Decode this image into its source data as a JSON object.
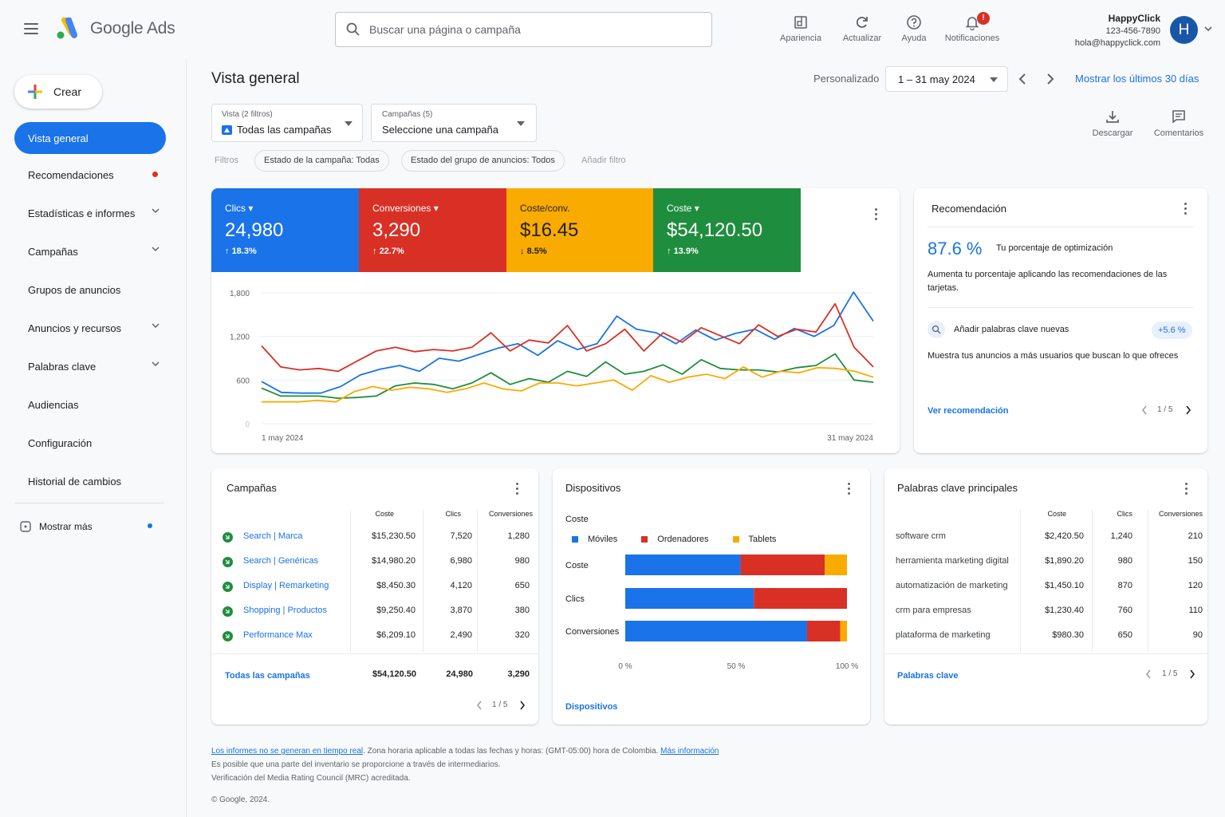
{
  "app": {
    "brand": "Google Ads"
  },
  "search": {
    "placeholder": "Buscar una página o campaña"
  },
  "toolbar": {
    "appearance": "Apariencia",
    "refresh": "Actualizar",
    "help": "Ayuda",
    "notifications": "Notificaciones",
    "notif_badge": "!"
  },
  "user": {
    "name": "HappyClick",
    "phone": "123-456-7890",
    "email": "hola@happyclick.com",
    "initial": "H"
  },
  "sidebar": {
    "create": "Crear",
    "items": [
      {
        "label": "Vista general"
      },
      {
        "label": "Recomendaciones"
      },
      {
        "label": "Estadísticas e informes"
      },
      {
        "label": "Campañas"
      },
      {
        "label": "Grupos de anuncios"
      },
      {
        "label": "Anuncios y recursos"
      },
      {
        "label": "Palabras clave"
      },
      {
        "label": "Audiencias"
      },
      {
        "label": "Configuración"
      },
      {
        "label": "Historial de cambios"
      }
    ],
    "more": "Mostrar más"
  },
  "page": {
    "title": "Vista general",
    "date_mode": "Personalizado",
    "date_range": "1 – 31 may 2024",
    "last30": "Mostrar los últimos 30 días",
    "view_label": "Vista (2 filtros)",
    "view_value": "Todas las campañas",
    "campaign_label": "Campañas (5)",
    "campaign_value": "Seleccione una campaña",
    "download": "Descargar",
    "comments": "Comentarios"
  },
  "filters": {
    "label": "Filtros",
    "chip1": "Estado de la campaña: Todas",
    "chip2": "Estado del grupo de anuncios: Todos",
    "add": "Añadir filtro"
  },
  "kpis": [
    {
      "label": "Clics",
      "value": "24,980",
      "change": "18.3%",
      "dir": "up",
      "color": "#1a73e8"
    },
    {
      "label": "Conversiones",
      "value": "3,290",
      "change": "22.7%",
      "dir": "up",
      "color": "#d93025"
    },
    {
      "label": "Coste/conv.",
      "value": "$16.45",
      "change": "8.5%",
      "dir": "down",
      "color": "#f9ab00"
    },
    {
      "label": "Coste",
      "value": "$54,120.50",
      "change": "13.9%",
      "dir": "up",
      "color": "#1e8e3e"
    }
  ],
  "chart_data": {
    "type": "line",
    "x_start": "1 may 2024",
    "x_end": "31 may 2024",
    "y_ticks": [
      "1,800",
      "1,200",
      "600",
      "0"
    ],
    "ylim": [
      0,
      1800
    ],
    "series": [
      {
        "color": "#1a73e8",
        "values": [
          580,
          430,
          420,
          420,
          510,
          670,
          750,
          800,
          720,
          900,
          860,
          950,
          1040,
          1100,
          940,
          1140,
          1020,
          1100,
          1480,
          1300,
          1250,
          1100,
          1290,
          1150,
          1240,
          1300,
          1160,
          1310,
          1200,
          1350,
          1810,
          1410
        ]
      },
      {
        "color": "#d93025",
        "values": [
          1070,
          780,
          740,
          760,
          720,
          860,
          1000,
          1050,
          990,
          1020,
          1000,
          1050,
          1250,
          1000,
          1150,
          1110,
          1350,
          1000,
          1100,
          1300,
          1000,
          1250,
          1120,
          1320,
          1210,
          1100,
          1360,
          1200,
          1300,
          1260,
          1650,
          1050,
          780
        ]
      },
      {
        "color": "#1e8e3e",
        "values": [
          490,
          380,
          380,
          380,
          350,
          360,
          380,
          520,
          560,
          540,
          480,
          560,
          700,
          540,
          620,
          570,
          720,
          650,
          850,
          680,
          720,
          810,
          680,
          880,
          760,
          740,
          740,
          710,
          770,
          800,
          960,
          600,
          570
        ]
      },
      {
        "color": "#f9ab00",
        "values": [
          300,
          300,
          300,
          320,
          300,
          440,
          510,
          460,
          500,
          480,
          430,
          480,
          560,
          480,
          450,
          560,
          560,
          520,
          560,
          600,
          460,
          660,
          570,
          640,
          680,
          620,
          780,
          640,
          720,
          700,
          770,
          760,
          720,
          640
        ]
      }
    ]
  },
  "recommendation": {
    "title": "Recomendación",
    "score": "87.6 %",
    "score_label": "Tu porcentaje de optimización",
    "desc": "Aumenta tu porcentaje aplicando las recomendaciones de las tarjetas.",
    "item_title": "Añadir palabras clave nuevas",
    "item_badge": "+5.6 %",
    "item_desc": "Muestra tus anuncios a más usuarios que buscan lo que ofreces",
    "link": "Ver recomendación",
    "pager": "1 / 5"
  },
  "campaigns": {
    "title": "Campañas",
    "headers": [
      "Coste",
      "Clics",
      "Conversiones"
    ],
    "rows": [
      {
        "name": "Search | Marca",
        "cost": "$15,230.50",
        "clicks": "7,520",
        "conv": "1,280"
      },
      {
        "name": "Search | Genéricas",
        "cost": "$14,980.20",
        "clicks": "6,980",
        "conv": "980"
      },
      {
        "name": "Display | Remarketing",
        "cost": "$8,450.30",
        "clicks": "4,120",
        "conv": "650"
      },
      {
        "name": "Shopping | Productos",
        "cost": "$9,250.40",
        "clicks": "3,870",
        "conv": "380"
      },
      {
        "name": "Performance Max",
        "cost": "$6,209.10",
        "clicks": "2,490",
        "conv": "320"
      }
    ],
    "total_label": "Todas las campañas",
    "total_cost": "$54,120.50",
    "total_clicks": "24,980",
    "total_conv": "3,290",
    "pager": "1 / 5"
  },
  "devices": {
    "title": "Dispositivos",
    "metric": "Coste",
    "legend": [
      {
        "name": "Móviles",
        "color": "#1a73e8"
      },
      {
        "name": "Ordenadores",
        "color": "#d93025"
      },
      {
        "name": "Tablets",
        "color": "#f9ab00"
      }
    ],
    "bars": [
      {
        "label": "Coste",
        "values": [
          52,
          38,
          10
        ]
      },
      {
        "label": "Clics",
        "values": [
          58,
          42,
          0
        ]
      },
      {
        "label": "Conversiones",
        "values": [
          82,
          15,
          3
        ]
      }
    ],
    "ticks": [
      "0 %",
      "50 %",
      "100 %"
    ],
    "link": "Dispositivos"
  },
  "keywords": {
    "title": "Palabras clave principales",
    "headers": [
      "Coste",
      "Clics",
      "Conversiones"
    ],
    "rows": [
      {
        "name": "software crm",
        "cost": "$2,420.50",
        "clicks": "1,240",
        "conv": "210"
      },
      {
        "name": "herramienta marketing digital",
        "cost": "$1,890.20",
        "clicks": "980",
        "conv": "150"
      },
      {
        "name": "automatización de marketing",
        "cost": "$1,450.10",
        "clicks": "870",
        "conv": "120"
      },
      {
        "name": "crm para empresas",
        "cost": "$1,230.40",
        "clicks": "760",
        "conv": "110"
      },
      {
        "name": "plataforma de marketing",
        "cost": "$980.30",
        "clicks": "650",
        "conv": "90"
      }
    ],
    "link": "Palabras clave",
    "pager": "1 / 5"
  },
  "footer": {
    "link1": "Los informes no se generan en tiempo real",
    "text1": ". Zona horaria aplicable a todas las fechas y horas: (GMT-05:00) hora de Colombia.",
    "link2": "Más información",
    "line2": "Es posible que una parte del inventario se proporcione a través de intermediarios.",
    "line3": "Verificación del Media Rating Council (MRC) acreditada.",
    "copyright": "© Google, 2024."
  }
}
